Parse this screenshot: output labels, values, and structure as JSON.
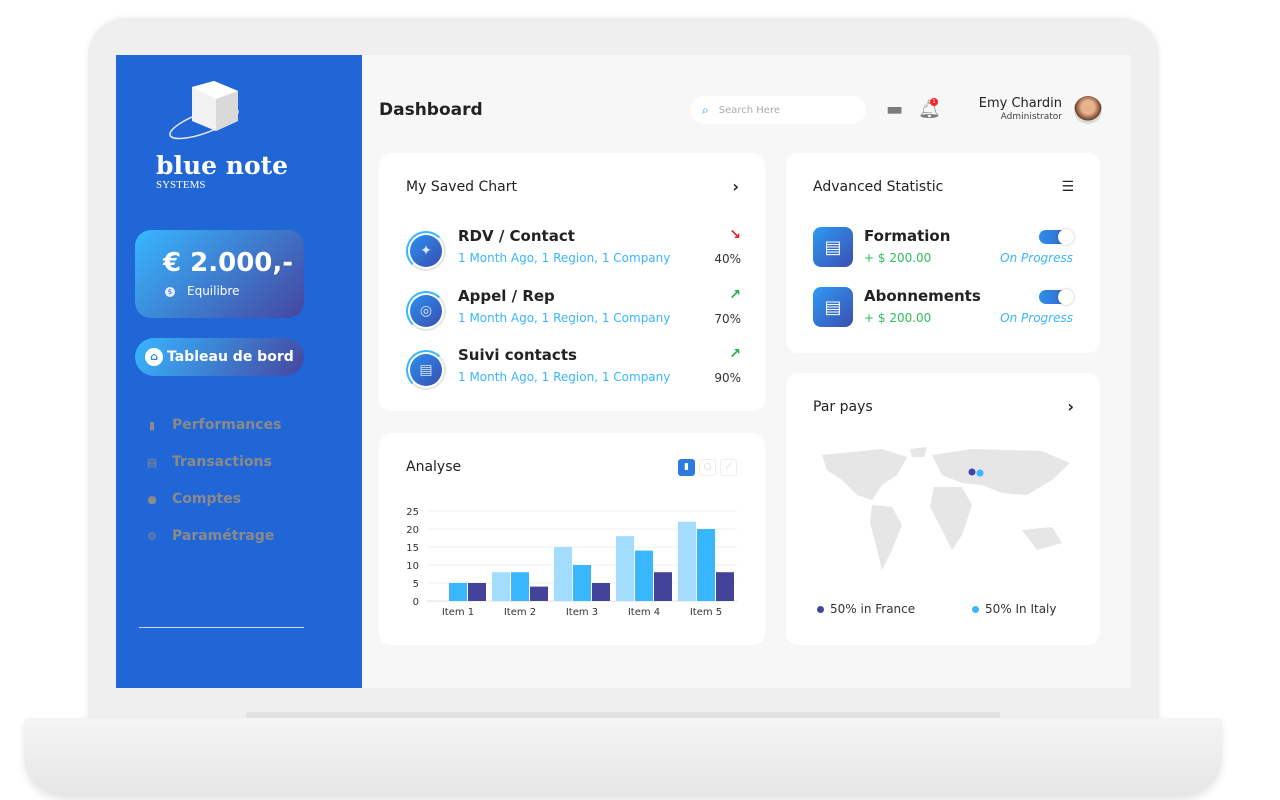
{
  "sidebar": {
    "brand": "blue note",
    "brand_sub": "SYSTEMS",
    "balance": {
      "amount": "€ 2.000,-",
      "label": "Equilibre"
    },
    "active_button": "Tableau de bord",
    "items": [
      {
        "label": "Performances",
        "icon": "bar-chart-icon"
      },
      {
        "label": "Transactions",
        "icon": "document-icon"
      },
      {
        "label": "Comptes",
        "icon": "user-icon"
      },
      {
        "label": "Paramétrage",
        "icon": "gear-icon"
      }
    ]
  },
  "header": {
    "title": "Dashboard",
    "search_placeholder": "Search Here",
    "user_name": "Emy  Chardin",
    "user_role": "Administrator",
    "notification_badge": "1"
  },
  "saved_chart": {
    "title": "My Saved Chart",
    "rows": [
      {
        "name": "RDV / Contact",
        "sub": "1 Month Ago, 1 Region, 1 Company",
        "pct": "40%",
        "trend": "down",
        "icon": "pin-icon"
      },
      {
        "name": "Appel  / Rep",
        "sub": "1 Month Ago, 1 Region, 1 Company",
        "pct": "70%",
        "trend": "up",
        "icon": "headphones-icon"
      },
      {
        "name": "Suivi  contacts",
        "sub": "1 Month Ago, 1 Region, 1 Company",
        "pct": "90%",
        "trend": "up",
        "icon": "notes-icon"
      }
    ]
  },
  "advanced": {
    "title": "Advanced Statistic",
    "rows": [
      {
        "name": "Formation",
        "amount": "+ $ 200.00",
        "status": "On Progress",
        "toggle": true
      },
      {
        "name": "Abonnements",
        "amount": "+ $ 200.00",
        "status": "On Progress",
        "toggle": true
      }
    ]
  },
  "countries": {
    "title": "Par pays",
    "legend": [
      {
        "label": "50% in France",
        "color": "#3f47a0"
      },
      {
        "label": "50% In Italy",
        "color": "#38b6ff"
      }
    ]
  },
  "colors": {
    "sidebar": "#2166d6",
    "up": "#22b04b",
    "down": "#f01d1d"
  },
  "chart_data": {
    "type": "bar",
    "title": "Analyse",
    "categories": [
      "Item 1",
      "Item 2",
      "Item 3",
      "Item 4",
      "Item 5"
    ],
    "series": [
      {
        "values": [
          0,
          8,
          15,
          18,
          22
        ],
        "color": "#a2dcff"
      },
      {
        "values": [
          5,
          8,
          10,
          14,
          20
        ],
        "color": "#38b6ff"
      },
      {
        "values": [
          5,
          4,
          5,
          8,
          8
        ],
        "color": "#424399"
      }
    ],
    "yticks": [
      0,
      5,
      10,
      15,
      20,
      25
    ],
    "ylim": [
      0,
      25
    ],
    "grid": true
  }
}
